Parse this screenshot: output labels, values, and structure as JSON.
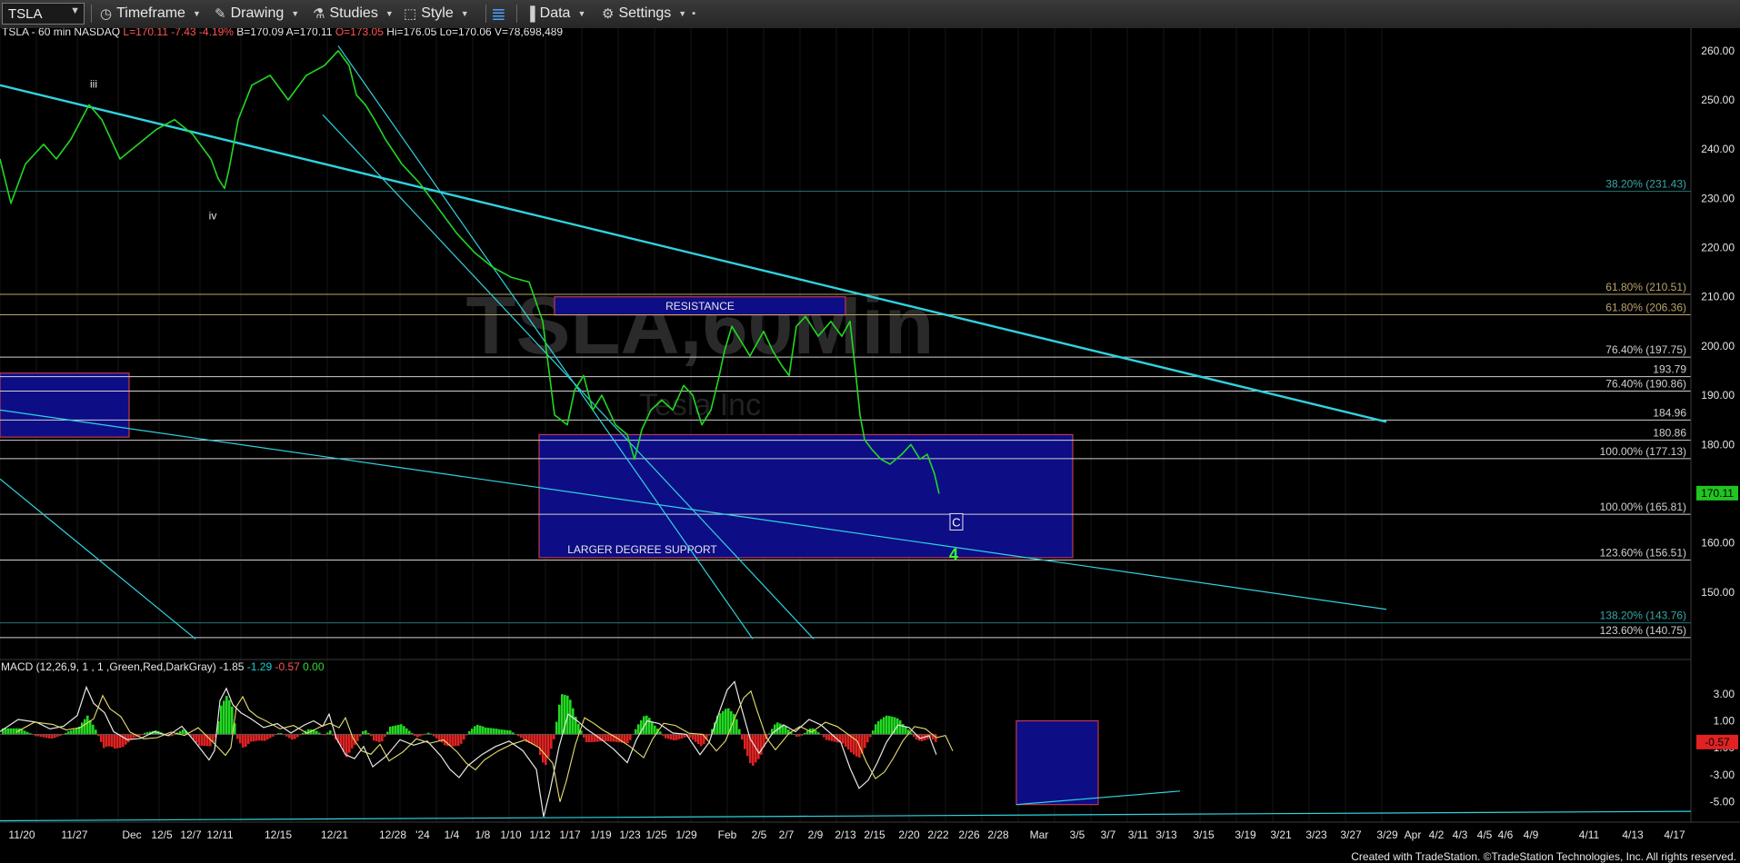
{
  "toolbar": {
    "symbol": "TSLA",
    "items": [
      {
        "label": "Timeframe",
        "icon": "clock-icon",
        "glyph": "◷"
      },
      {
        "label": "Drawing",
        "icon": "pencil-icon",
        "glyph": "✎"
      },
      {
        "label": "Studies",
        "icon": "flask-icon",
        "glyph": "⚗"
      },
      {
        "label": "Style",
        "icon": "style-icon",
        "glyph": "⬚"
      },
      {
        "label": "",
        "icon": "layout-icon",
        "glyph": "≣"
      },
      {
        "label": "Data",
        "icon": "data-chart-icon",
        "glyph": "▐"
      },
      {
        "label": "Settings",
        "icon": "gear-icon",
        "glyph": "⚙"
      }
    ]
  },
  "header": {
    "title": "TSLA - 60 min  NASDAQ",
    "fields": [
      {
        "text": "L=170.11",
        "color": "#ff5555"
      },
      {
        "text": "-7.43",
        "color": "#ff5555"
      },
      {
        "text": "-4.19%",
        "color": "#ff5555"
      },
      {
        "text": "B=170.09",
        "color": "#e6e6e6"
      },
      {
        "text": "A=170.11",
        "color": "#e6e6e6"
      },
      {
        "text": "O=173.05",
        "color": "#ff5555"
      },
      {
        "text": "Hi=176.05",
        "color": "#e6e6e6"
      },
      {
        "text": "Lo=170.06",
        "color": "#e6e6e6"
      },
      {
        "text": "V=78,698,489",
        "color": "#e6e6e6"
      }
    ]
  },
  "watermark": {
    "symbol": "TSLA,60Min",
    "name": "Tesla Inc"
  },
  "chart_data": {
    "type": "line",
    "price_axis": {
      "min": 140,
      "max": 262,
      "ticks": [
        150,
        160,
        170,
        180,
        190,
        200,
        210,
        220,
        230,
        240,
        250,
        260
      ]
    },
    "last_price": "170.11",
    "date_ticks": [
      "11/20",
      "11/27",
      "Dec",
      "12/5",
      "12/7",
      "12/11",
      "12/15",
      "12/21",
      "12/28",
      "'24",
      "1/4",
      "1/8",
      "1/10",
      "1/12",
      "1/17",
      "1/19",
      "1/23",
      "1/25",
      "1/29",
      "Feb",
      "2/5",
      "2/7",
      "2/9",
      "2/13",
      "2/15",
      "2/20",
      "2/22",
      "2/26",
      "2/28",
      "Mar",
      "3/5",
      "3/7",
      "3/11",
      "3/13",
      "3/15",
      "3/19",
      "3/21",
      "3/23",
      "3/27",
      "3/29",
      "Apr",
      "4/2",
      "4/3",
      "4/5",
      "4/6",
      "4/9",
      "4/11",
      "4/13",
      "4/17"
    ],
    "price_series": [
      [
        0,
        238
      ],
      [
        12,
        229
      ],
      [
        28,
        237
      ],
      [
        48,
        241
      ],
      [
        62,
        238
      ],
      [
        78,
        242
      ],
      [
        98,
        249
      ],
      [
        112,
        246
      ],
      [
        132,
        238
      ],
      [
        152,
        241
      ],
      [
        172,
        244
      ],
      [
        192,
        246
      ],
      [
        212,
        243
      ],
      [
        232,
        238
      ],
      [
        240,
        234
      ],
      [
        247,
        232
      ],
      [
        252,
        236
      ],
      [
        262,
        246
      ],
      [
        277,
        253
      ],
      [
        297,
        255
      ],
      [
        317,
        250
      ],
      [
        337,
        255
      ],
      [
        357,
        257
      ],
      [
        372,
        260
      ],
      [
        384,
        257
      ],
      [
        392,
        251
      ],
      [
        402,
        249
      ],
      [
        412,
        246
      ],
      [
        424,
        242
      ],
      [
        442,
        237
      ],
      [
        462,
        233
      ],
      [
        482,
        228
      ],
      [
        502,
        223
      ],
      [
        522,
        219
      ],
      [
        542,
        216
      ],
      [
        562,
        214
      ],
      [
        582,
        213
      ],
      [
        597,
        205
      ],
      [
        610,
        186
      ],
      [
        624,
        184
      ],
      [
        632,
        191
      ],
      [
        642,
        194
      ],
      [
        652,
        187
      ],
      [
        662,
        190
      ],
      [
        677,
        184
      ],
      [
        690,
        182
      ],
      [
        698,
        177
      ],
      [
        706,
        183
      ],
      [
        716,
        187
      ],
      [
        728,
        189
      ],
      [
        740,
        187
      ],
      [
        752,
        192
      ],
      [
        762,
        190
      ],
      [
        772,
        184
      ],
      [
        782,
        187
      ],
      [
        790,
        193
      ],
      [
        797,
        199
      ],
      [
        805,
        204
      ],
      [
        815,
        201
      ],
      [
        825,
        198
      ],
      [
        840,
        203
      ],
      [
        850,
        199
      ],
      [
        860,
        196
      ],
      [
        868,
        194
      ],
      [
        876,
        204
      ],
      [
        886,
        206
      ],
      [
        900,
        202
      ],
      [
        914,
        205
      ],
      [
        926,
        202
      ],
      [
        935,
        205
      ],
      [
        941,
        195
      ],
      [
        946,
        186
      ],
      [
        951,
        181
      ],
      [
        959,
        179
      ],
      [
        969,
        177
      ],
      [
        979,
        176
      ],
      [
        992,
        178
      ],
      [
        1002,
        180
      ],
      [
        1012,
        177
      ],
      [
        1020,
        178
      ],
      [
        1028,
        174
      ],
      [
        1033,
        170
      ]
    ],
    "fib_levels": [
      {
        "label": "38.20% (231.43)",
        "value": 231.43,
        "color": "#1f7a7a"
      },
      {
        "label": "61.80% (210.51)",
        "value": 210.51,
        "color": "#b9a36a"
      },
      {
        "label": "61.80% (206.36)",
        "value": 206.36,
        "color": "#b9a36a"
      },
      {
        "label": "76.40% (197.75)",
        "value": 197.75,
        "color": "#d0d0d0"
      },
      {
        "label": "193.79",
        "value": 193.79,
        "color": "#d0d0d0"
      },
      {
        "label": "76.40% (190.86)",
        "value": 190.86,
        "color": "#d0d0d0"
      },
      {
        "label": "184.96",
        "value": 184.96,
        "color": "#d0d0d0"
      },
      {
        "label": "180.86",
        "value": 180.86,
        "color": "#d0d0d0"
      },
      {
        "label": "100.00% (177.13)",
        "value": 177.13,
        "color": "#d0d0d0"
      },
      {
        "label": "100.00% (165.81)",
        "value": 165.81,
        "color": "#d0d0d0"
      },
      {
        "label": "123.60% (156.51)",
        "value": 156.51,
        "color": "#d0d0d0"
      },
      {
        "label": "138.20% (143.76)",
        "value": 143.76,
        "color": "#1f7a7a"
      },
      {
        "label": "123.60% (140.75)",
        "value": 140.75,
        "color": "#d0d0d0"
      }
    ],
    "zones": [
      {
        "label": "RESISTANCE",
        "x_start": 610,
        "x_end": 930,
        "price_high": 210,
        "price_low": 206.3
      },
      {
        "label": "LARGER DEGREE SUPPORT",
        "x_start": 593,
        "x_end": 1180,
        "price_high": 182,
        "price_low": 157
      },
      {
        "label": "",
        "x_start": 0,
        "x_end": 142,
        "price_high": 194.5,
        "price_low": 181.5
      }
    ],
    "trendlines": [
      {
        "x1": 0,
        "y1": 253,
        "x2": 1525,
        "y2": 184.6,
        "width": 2.4
      },
      {
        "x1": 0,
        "y1": 187,
        "x2": 1525,
        "y2": 146.5,
        "width": 1.2
      },
      {
        "x1": 372,
        "y1": 261,
        "x2": 828,
        "y2": 140.5,
        "width": 1.2
      },
      {
        "x1": 355,
        "y1": 247,
        "x2": 895,
        "y2": 140.5,
        "width": 1.2
      },
      {
        "x1": 0,
        "y1": 173,
        "x2": 215,
        "y2": 140.5,
        "width": 1.2
      }
    ],
    "wave_labels": [
      {
        "text": "iii",
        "x": 103,
        "price": 253.2,
        "color": "#e6e6e6",
        "size": 12
      },
      {
        "text": "iv",
        "x": 234,
        "price": 226.5,
        "color": "#e6e6e6",
        "size": 12
      },
      {
        "text": "C",
        "x": 1052,
        "price": 164.1,
        "color": "#ffffff",
        "size": 13
      },
      {
        "text": "4",
        "x": 1049,
        "price": 157.3,
        "color": "#33ff33",
        "size": 18
      }
    ],
    "macd": {
      "label": "MACD (12,26,9, 1 , 1 ,Green,Red,DarkGray)",
      "values": [
        "-1.85",
        "-1.29",
        "-0.57",
        "0.00"
      ],
      "value_colors": [
        "#e6e6e6",
        "#18d0d0",
        "#ff5555",
        "#33dd33"
      ],
      "axis_min": -6.5,
      "axis_max": 4.6,
      "ticks": [
        "3.00",
        "1.00",
        "-1.00",
        "-3.00",
        "-5.00"
      ],
      "tick_values": [
        3,
        1,
        -1,
        -3,
        -5
      ],
      "last_value": "-0.57",
      "series": [
        [
          0,
          0.2
        ],
        [
          20,
          1.1
        ],
        [
          40,
          0.9
        ],
        [
          55,
          0.4
        ],
        [
          70,
          0.6
        ],
        [
          85,
          1.4
        ],
        [
          95,
          3.5
        ],
        [
          103,
          2.3
        ],
        [
          115,
          1.6
        ],
        [
          125,
          0.2
        ],
        [
          140,
          -0.4
        ],
        [
          155,
          -0.3
        ],
        [
          170,
          0.2
        ],
        [
          185,
          -0.1
        ],
        [
          200,
          0.6
        ],
        [
          215,
          -0.6
        ],
        [
          230,
          -1.9
        ],
        [
          236,
          -1.2
        ],
        [
          242,
          2.5
        ],
        [
          249,
          3.4
        ],
        [
          256,
          2.2
        ],
        [
          265,
          1.6
        ],
        [
          275,
          1.2
        ],
        [
          290,
          0.5
        ],
        [
          305,
          0.8
        ],
        [
          320,
          0.1
        ],
        [
          335,
          0.7
        ],
        [
          345,
          1.0
        ],
        [
          355,
          0.6
        ],
        [
          362,
          1.5
        ],
        [
          370,
          -0.3
        ],
        [
          380,
          -1.5
        ],
        [
          390,
          -1.8
        ],
        [
          400,
          -0.9
        ],
        [
          410,
          -2.4
        ],
        [
          425,
          -1.6
        ],
        [
          440,
          -0.4
        ],
        [
          455,
          -0.8
        ],
        [
          470,
          -0.5
        ],
        [
          485,
          -1.6
        ],
        [
          495,
          -2.6
        ],
        [
          505,
          -3.2
        ],
        [
          515,
          -2.3
        ],
        [
          530,
          -1.5
        ],
        [
          545,
          -0.9
        ],
        [
          560,
          -0.5
        ],
        [
          575,
          -1.2
        ],
        [
          590,
          -2.6
        ],
        [
          598,
          -6.1
        ],
        [
          605,
          -4.2
        ],
        [
          615,
          -0.9
        ],
        [
          625,
          1.5
        ],
        [
          635,
          1.0
        ],
        [
          645,
          0.4
        ],
        [
          660,
          -0.3
        ],
        [
          675,
          -1.1
        ],
        [
          690,
          -2.1
        ],
        [
          700,
          -0.4
        ],
        [
          712,
          1.0
        ],
        [
          725,
          0.8
        ],
        [
          740,
          0.1
        ],
        [
          755,
          0.0
        ],
        [
          770,
          -1.5
        ],
        [
          780,
          -0.6
        ],
        [
          792,
          1.8
        ],
        [
          800,
          3.3
        ],
        [
          808,
          3.9
        ],
        [
          815,
          2.1
        ],
        [
          825,
          -0.3
        ],
        [
          835,
          -1.4
        ],
        [
          850,
          0.1
        ],
        [
          862,
          0.7
        ],
        [
          875,
          0.2
        ],
        [
          890,
          1.1
        ],
        [
          903,
          0.7
        ],
        [
          915,
          0.0
        ],
        [
          925,
          -0.6
        ],
        [
          935,
          -2.5
        ],
        [
          945,
          -4.0
        ],
        [
          955,
          -3.4
        ],
        [
          965,
          -2.1
        ],
        [
          975,
          -0.6
        ],
        [
          988,
          0.7
        ],
        [
          1000,
          0.5
        ],
        [
          1012,
          -0.3
        ],
        [
          1022,
          -0.1
        ],
        [
          1030,
          -1.5
        ]
      ]
    }
  },
  "footer": {
    "credit": "Created with TradeStation. ©TradeStation Technologies, Inc. All rights reserved."
  }
}
